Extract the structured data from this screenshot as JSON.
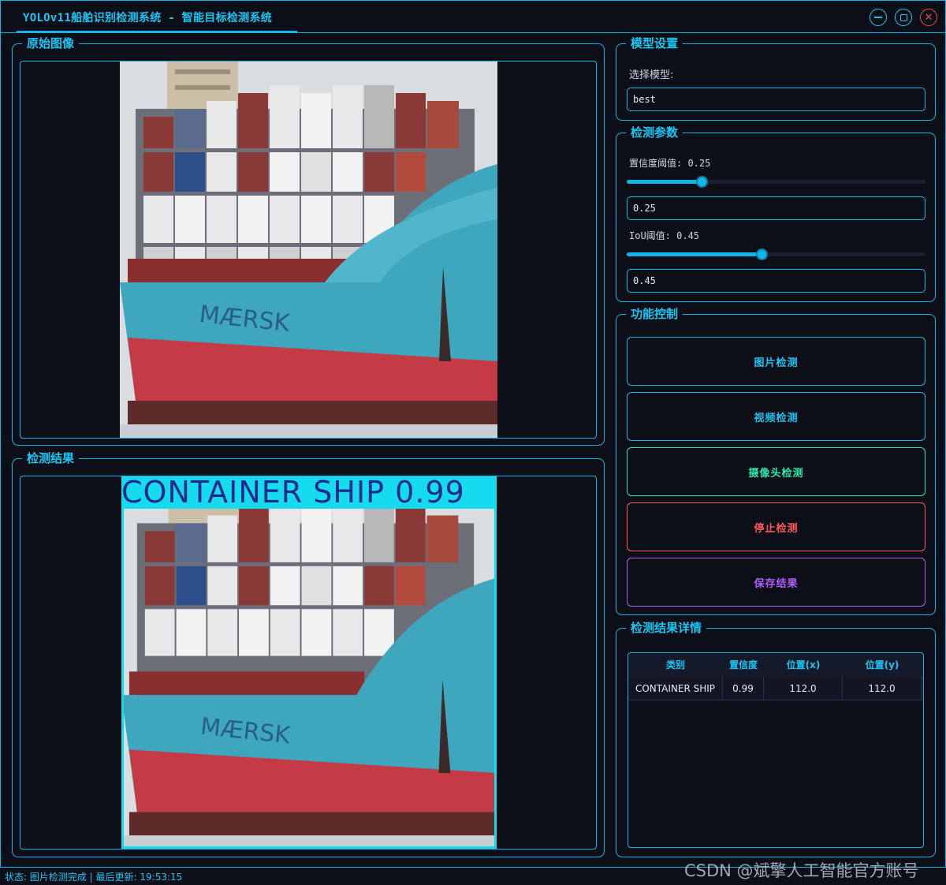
{
  "window": {
    "title": "YOLOv11船舶识别检测系统 - 智能目标检测系统"
  },
  "original_panel": {
    "title": "原始图像"
  },
  "result_panel": {
    "title": "检测结果",
    "detection_label": "CONTAINER SHIP 0.99"
  },
  "model_settings": {
    "title": "模型设置",
    "select_label": "选择模型:",
    "selected_model": "best"
  },
  "detection_params": {
    "title": "检测参数",
    "confidence_label": "置信度阈值: 0.25",
    "confidence_value": "0.25",
    "confidence_fraction": 0.25,
    "iou_label": "IoU阈值: 0.45",
    "iou_value": "0.45",
    "iou_fraction": 0.45
  },
  "controls": {
    "title": "功能控制",
    "image_detect": "图片检测",
    "video_detect": "视频检测",
    "camera_detect": "摄像头检测",
    "stop_detect": "停止检测",
    "save_results": "保存结果"
  },
  "results_detail": {
    "title": "检测结果详情",
    "columns": [
      "类别",
      "置信度",
      "位置(x)",
      "位置(y)"
    ],
    "rows": [
      [
        "CONTAINER SHIP",
        "0.99",
        "112.0",
        "112.0"
      ]
    ]
  },
  "status_bar": {
    "text": "状态: 图片检测完成 | 最后更新: 19:53:15"
  },
  "watermark": "CSDN @斌擎人工智能官方账号",
  "colors": {
    "accent": "#12b5e5",
    "camera_button": "#2ee6a8",
    "stop_button": "#ff5a5a",
    "save_button": "#b05cff",
    "background": "#0d0f18"
  }
}
